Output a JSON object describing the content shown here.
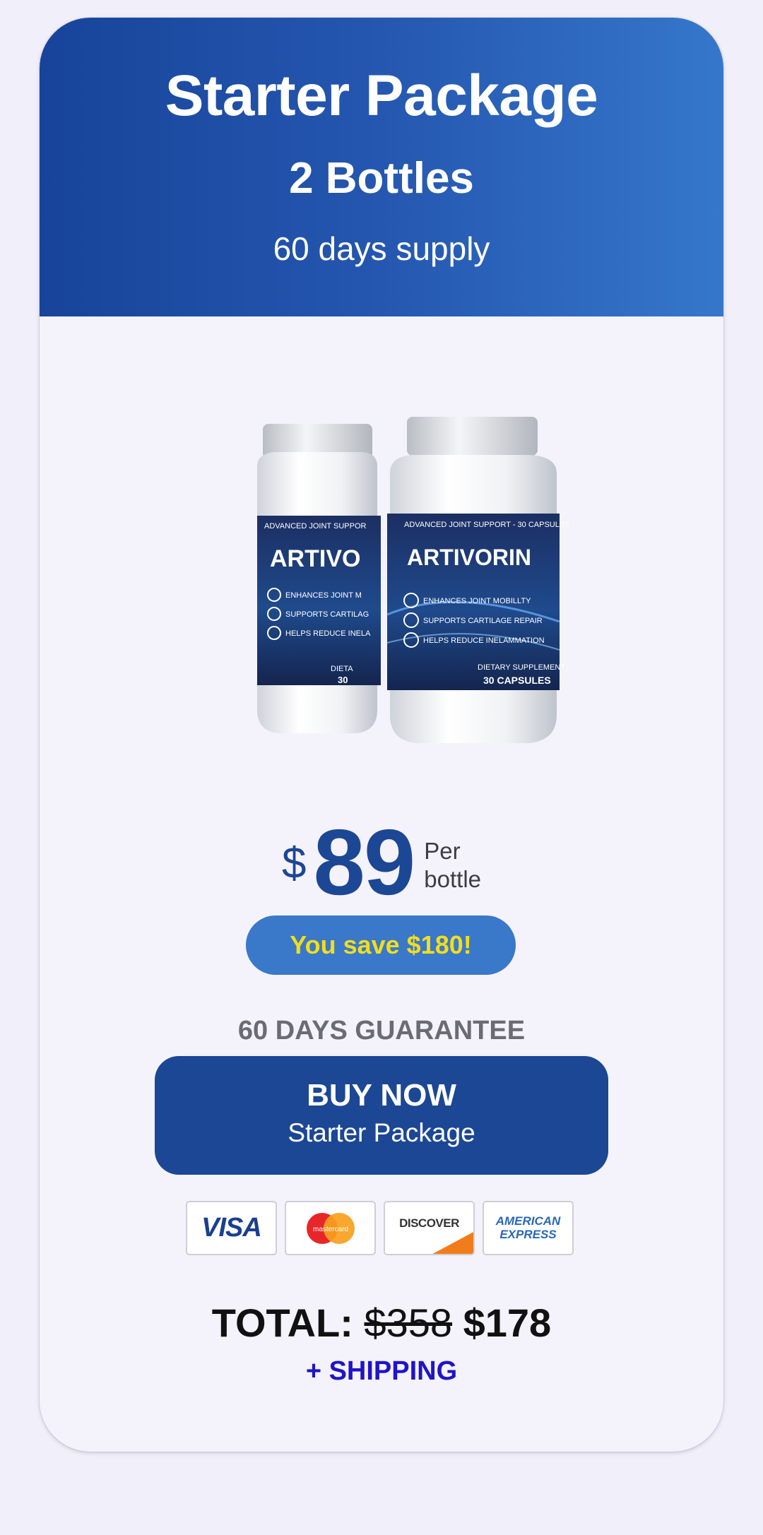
{
  "header": {
    "title": "Starter Package",
    "subtitle": "2 Bottles",
    "supply": "60 days supply"
  },
  "product": {
    "label_top": "ADVANCED JOINT SUPPORT - 30 CAPSULES",
    "label_top_back": "ADVANCED JOINT SUPPOR",
    "brand": "ARTIVORIN",
    "brand_back": "ARTIVO",
    "benefits": [
      "ENHANCES JOINT MOBILLTY",
      "SUPPORTS CARTILAGE REPAIR",
      "HELPS REDUCE INELAMMATION"
    ],
    "benefits_back": [
      "ENHANCES JOINT M",
      "SUPPORTS CARTILAG",
      "HELPS REDUCE INELA"
    ],
    "type": "DIETARY SUPPLEMENT",
    "type_back": "DIETA",
    "count": "30 CAPSULES",
    "count_back": "30"
  },
  "price": {
    "currency": "$",
    "amount": "89",
    "per_line1": "Per",
    "per_line2": "bottle"
  },
  "savings": "You save $180!",
  "guarantee": "60 DAYS GUARANTEE",
  "buy_button": {
    "label": "BUY NOW",
    "sublabel": "Starter Package"
  },
  "payment_methods": [
    {
      "icon": "visa-icon",
      "label": "VISA"
    },
    {
      "icon": "mastercard-icon",
      "label": "mastercard"
    },
    {
      "icon": "discover-icon",
      "label": "DISCOVER"
    },
    {
      "icon": "amex-icon",
      "label_line1": "AMERICAN",
      "label_line2": "EXPRESS"
    }
  ],
  "total": {
    "label": "TOTAL:",
    "old_price": "$358",
    "new_price": "$178"
  },
  "shipping": "+ SHIPPING",
  "colors": {
    "header_start": "#17449a",
    "header_end": "#3577cb",
    "accent": "#1b4795",
    "savings_bg": "#3a78c9",
    "savings_text": "#f2dd1c",
    "shipping_text": "#1f14c8"
  }
}
